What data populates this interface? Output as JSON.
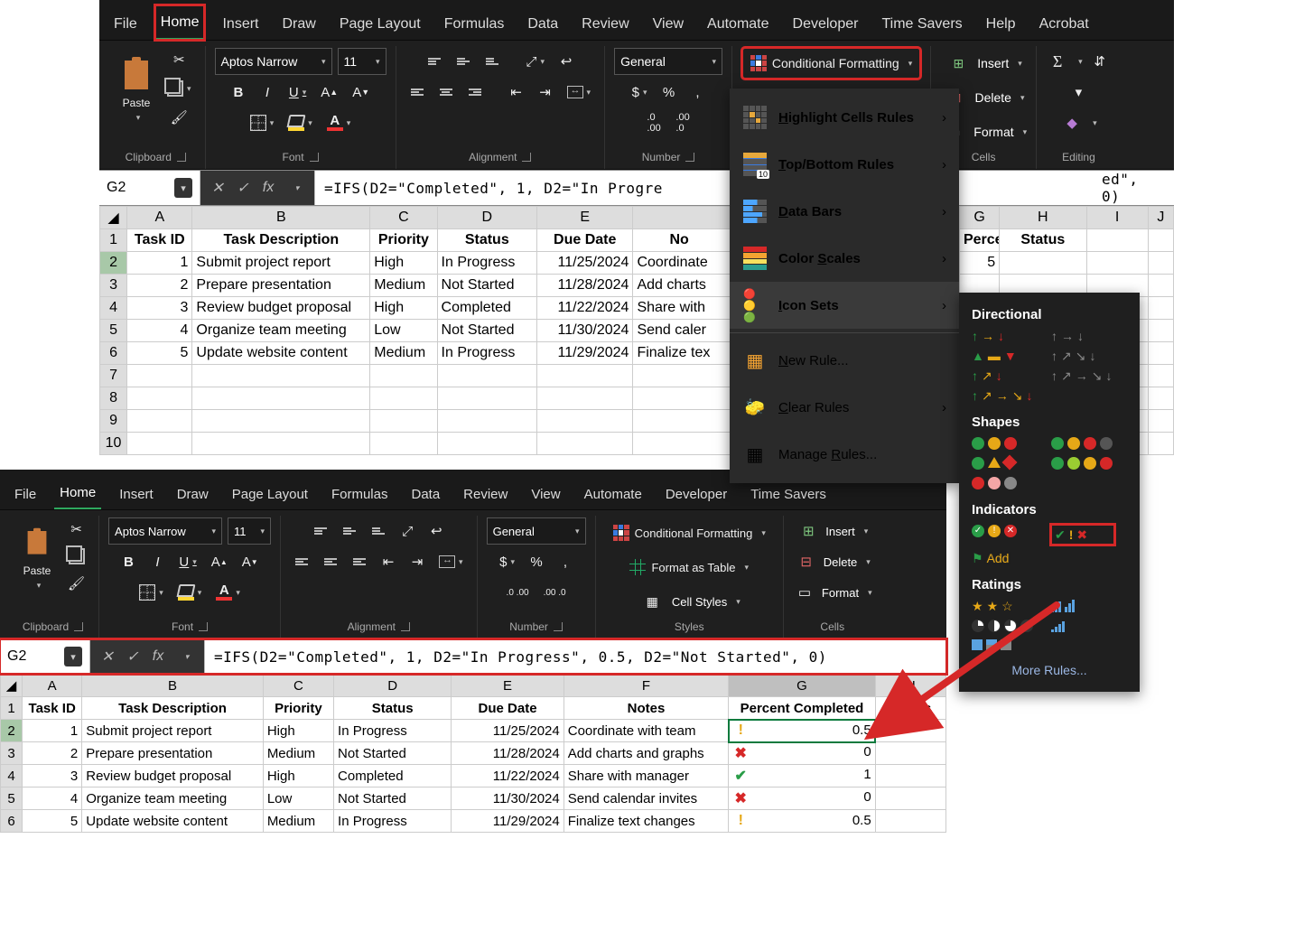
{
  "tabs": [
    "File",
    "Home",
    "Insert",
    "Draw",
    "Page Layout",
    "Formulas",
    "Data",
    "Review",
    "View",
    "Automate",
    "Developer",
    "Time Savers",
    "Help",
    "Acrobat"
  ],
  "tabs_small": [
    "File",
    "Home",
    "Insert",
    "Draw",
    "Page Layout",
    "Formulas",
    "Data",
    "Review",
    "View",
    "Automate",
    "Developer",
    "Time Savers"
  ],
  "active_tab": "Home",
  "ribbon": {
    "clipboard": {
      "paste": "Paste",
      "label": "Clipboard"
    },
    "font": {
      "name": "Aptos Narrow",
      "size": "11",
      "label": "Font"
    },
    "alignment": {
      "label": "Alignment"
    },
    "number": {
      "format": "General",
      "label": "Number"
    },
    "styles": {
      "cf": "Conditional Formatting",
      "fat": "Format as Table",
      "cs": "Cell Styles",
      "label": "Styles"
    },
    "cells": {
      "insert": "Insert",
      "delete": "Delete",
      "format": "Format",
      "label": "Cells"
    },
    "editing": {
      "label": "Editing"
    }
  },
  "formula_bar": {
    "namebox": "G2",
    "formula_full": "=IFS(D2=\"Completed\", 1, D2=\"In Progress\", 0.5, D2=\"Not Started\", 0)",
    "formula_cut": "=IFS(D2=\"Completed\", 1, D2=\"In Progre",
    "formula_tail": "ed\", 0)"
  },
  "sheet1": {
    "cols": [
      "A",
      "B",
      "C",
      "D",
      "E",
      "F",
      "G",
      "H",
      "I",
      "J"
    ],
    "widths": [
      72,
      196,
      74,
      110,
      106,
      176,
      160,
      96,
      68,
      28
    ],
    "headers": [
      "Task ID",
      "Task Description",
      "Priority",
      "Status",
      "Due Date",
      "Notes",
      "Percent Completed",
      "Status"
    ],
    "pc_short_header": "Percent Completed",
    "pc_short_value": "5",
    "rows": [
      {
        "id": 1,
        "desc": "Submit project report",
        "pri": "High",
        "stat": "In Progress",
        "due": "11/25/2024",
        "notes": "Coordinate"
      },
      {
        "id": 2,
        "desc": "Prepare presentation",
        "pri": "Medium",
        "stat": "Not Started",
        "due": "11/28/2024",
        "notes": "Add charts"
      },
      {
        "id": 3,
        "desc": "Review budget proposal",
        "pri": "High",
        "stat": "Completed",
        "due": "11/22/2024",
        "notes": "Share with"
      },
      {
        "id": 4,
        "desc": "Organize team meeting",
        "pri": "Low",
        "stat": "Not Started",
        "due": "11/30/2024",
        "notes": "Send caler"
      },
      {
        "id": 5,
        "desc": "Update website content",
        "pri": "Medium",
        "stat": "In Progress",
        "due": "11/29/2024",
        "notes": "Finalize tex"
      }
    ]
  },
  "sheet2": {
    "cols": [
      "A",
      "B",
      "C",
      "D",
      "E",
      "F",
      "G",
      "H"
    ],
    "widths": [
      70,
      200,
      78,
      132,
      126,
      180,
      160,
      78
    ],
    "headers": [
      "Task ID",
      "Task Description",
      "Priority",
      "Status",
      "Due Date",
      "Notes",
      "Percent Completed",
      "Status"
    ],
    "rows": [
      {
        "id": 1,
        "desc": "Submit project report",
        "pri": "High",
        "stat": "In Progress",
        "due": "11/25/2024",
        "notes": "Coordinate with team",
        "pc": 0.5,
        "ind": "exc"
      },
      {
        "id": 2,
        "desc": "Prepare presentation",
        "pri": "Medium",
        "stat": "Not Started",
        "due": "11/28/2024",
        "notes": "Add charts and graphs",
        "pc": 0,
        "ind": "cross"
      },
      {
        "id": 3,
        "desc": "Review budget proposal",
        "pri": "High",
        "stat": "Completed",
        "due": "11/22/2024",
        "notes": "Share with manager",
        "pc": 1,
        "ind": "check"
      },
      {
        "id": 4,
        "desc": "Organize team meeting",
        "pri": "Low",
        "stat": "Not Started",
        "due": "11/30/2024",
        "notes": "Send calendar invites",
        "pc": 0,
        "ind": "cross"
      },
      {
        "id": 5,
        "desc": "Update website content",
        "pri": "Medium",
        "stat": "In Progress",
        "due": "11/29/2024",
        "notes": "Finalize text changes",
        "pc": 0.5,
        "ind": "exc"
      }
    ]
  },
  "cf_menu": {
    "items": [
      "Highlight Cells Rules",
      "Top/Bottom Rules",
      "Data Bars",
      "Color Scales",
      "Icon Sets"
    ],
    "extra": [
      "New Rule...",
      "Clear Rules",
      "Manage Rules..."
    ]
  },
  "iconset_flyout": {
    "sections": [
      "Directional",
      "Shapes",
      "Indicators",
      "Ratings"
    ],
    "more": "More Rules...",
    "add_hint": "Add"
  }
}
